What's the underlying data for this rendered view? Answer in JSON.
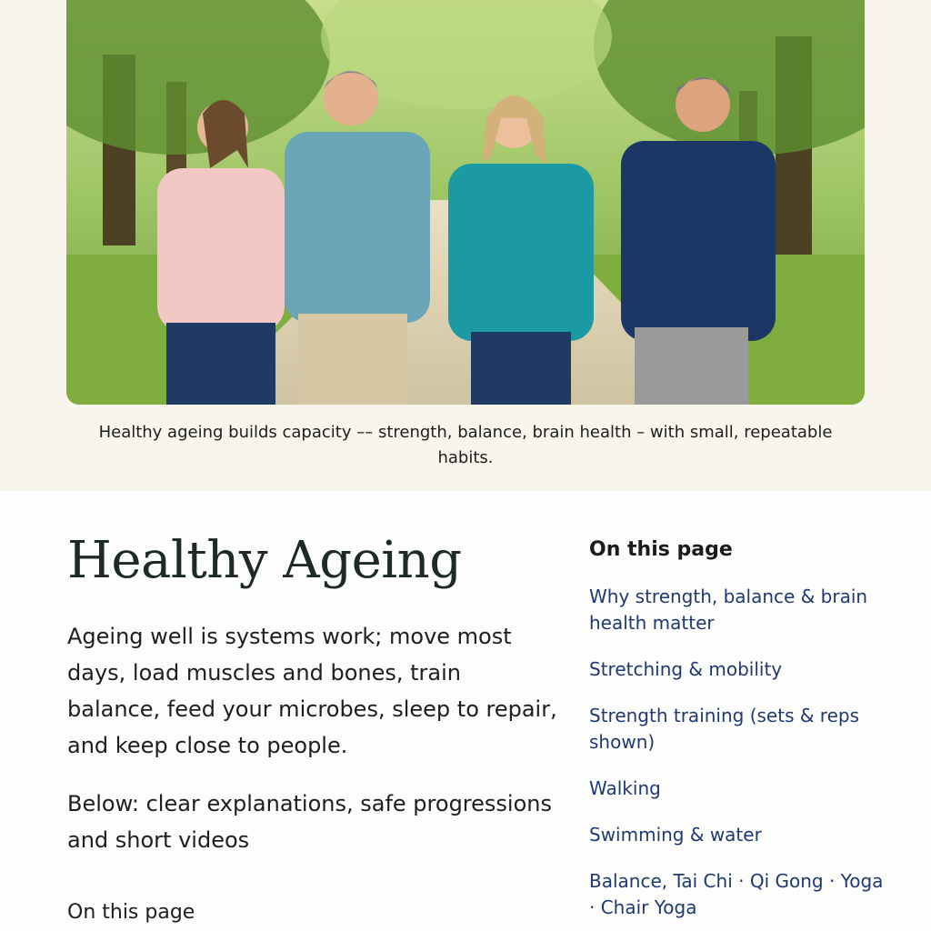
{
  "hero": {
    "image_alt": "Four adults walking together on a tree-lined path",
    "caption": "Healthy ageing builds capacity –– strength, balance, brain health – with small, repeatable habits."
  },
  "main": {
    "title": "Healthy Ageing",
    "lead": "Ageing well is systems work; move most days, load muscles and bones, train balance, feed your microbes, sleep to repair, and keep close to people.",
    "lead2": "Below: clear explanations, safe progressions and short videos",
    "on_this_page_inline": "On this page"
  },
  "toc": {
    "heading": "On this page",
    "items": [
      {
        "label": "Why strength, balance & brain health matter"
      },
      {
        "label": "Stretching & mobility"
      },
      {
        "label": "Strength training (sets & reps shown)"
      },
      {
        "label": "Walking"
      },
      {
        "label": "Swimming & water"
      },
      {
        "label": "Balance, Tai Chi · Qi Gong · Yoga · Chair Yoga"
      }
    ]
  },
  "colors": {
    "link": "#1f3a73",
    "title": "#1d2b24",
    "hero_bg": "#f8f5ec"
  }
}
